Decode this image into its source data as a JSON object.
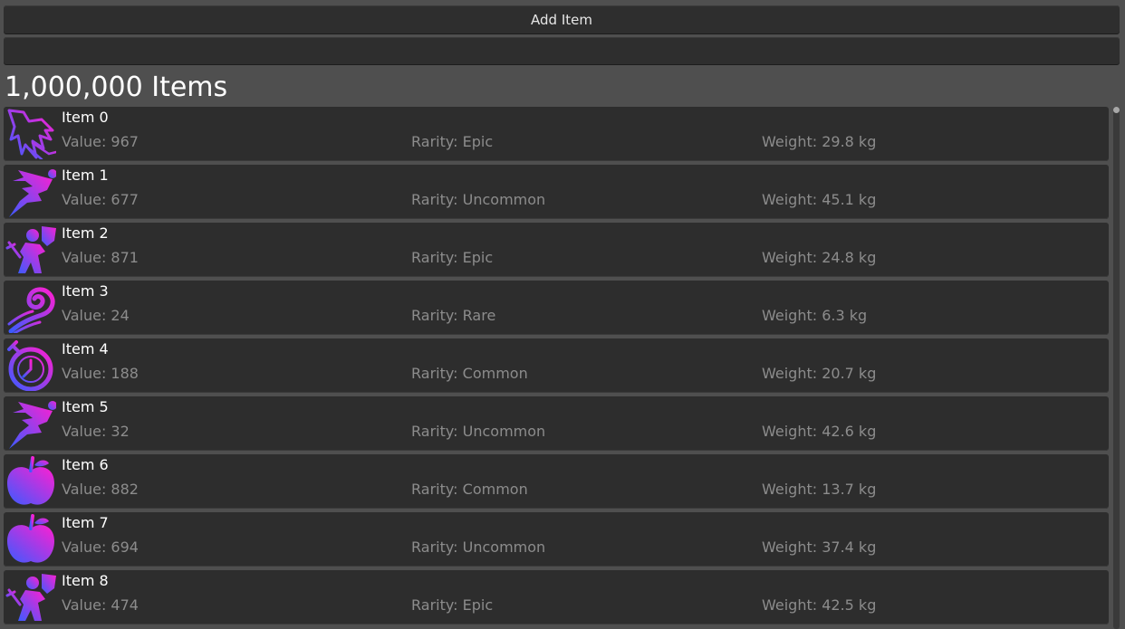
{
  "toolbar": {
    "add_label": "Add Item"
  },
  "search": {
    "value": "",
    "placeholder": ""
  },
  "list": {
    "title": "1,000,000 Items",
    "scroll_position": 0,
    "items": [
      {
        "name": "Item 0",
        "value": "Value: 967",
        "rarity": "Rarity: Epic",
        "weight": "Weight: 29.8 kg",
        "icon": "lightning-icon"
      },
      {
        "name": "Item 1",
        "value": "Value: 677",
        "rarity": "Rarity: Uncommon",
        "weight": "Weight: 45.1 kg",
        "icon": "running-figure-icon"
      },
      {
        "name": "Item 2",
        "value": "Value: 871",
        "rarity": "Rarity: Epic",
        "weight": "Weight: 24.8 kg",
        "icon": "knight-icon"
      },
      {
        "name": "Item 3",
        "value": "Value: 24",
        "rarity": "Rarity: Rare",
        "weight": "Weight: 6.3 kg",
        "icon": "wind-spiral-icon"
      },
      {
        "name": "Item 4",
        "value": "Value: 188",
        "rarity": "Rarity: Common",
        "weight": "Weight: 20.7 kg",
        "icon": "stopwatch-icon"
      },
      {
        "name": "Item 5",
        "value": "Value: 32",
        "rarity": "Rarity: Uncommon",
        "weight": "Weight: 42.6 kg",
        "icon": "running-figure-icon"
      },
      {
        "name": "Item 6",
        "value": "Value: 882",
        "rarity": "Rarity: Common",
        "weight": "Weight: 13.7 kg",
        "icon": "apple-icon"
      },
      {
        "name": "Item 7",
        "value": "Value: 694",
        "rarity": "Rarity: Uncommon",
        "weight": "Weight: 37.4 kg",
        "icon": "apple-icon"
      },
      {
        "name": "Item 8",
        "value": "Value: 474",
        "rarity": "Rarity: Epic",
        "weight": "Weight: 42.5 kg",
        "icon": "knight-icon"
      }
    ]
  },
  "colors": {
    "background": "#4f4f4f",
    "row_background": "#2d2d2d",
    "button_background": "#2e2e2e",
    "stat_text": "#8c8c8c",
    "icon_gradient_start": "#3b5bff",
    "icon_gradient_end": "#ff1fd1"
  }
}
